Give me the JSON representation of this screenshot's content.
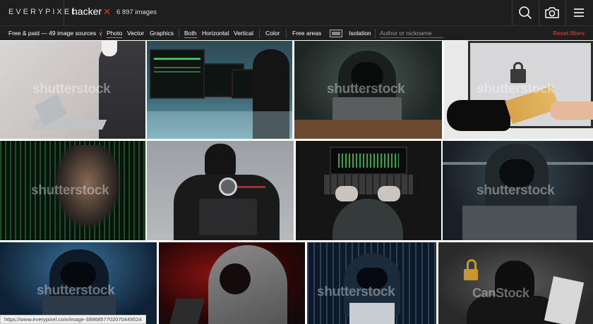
{
  "header": {
    "logo": "EVERYPIXEL",
    "query": "hacker",
    "clear_icon": "close-x",
    "image_count": "6 897 images",
    "icons": [
      "search-icon",
      "camera-icon",
      "menu-icon"
    ]
  },
  "filters": {
    "sources": "Free & paid — 49 image sources",
    "type_photo": "Photo",
    "type_vector": "Vector",
    "type_graphics": "Graphics",
    "orient_both": "Both",
    "orient_horizontal": "Horizontal",
    "orient_vertical": "Vertical",
    "color": "Color",
    "free_areas": "Free areas",
    "isolation": "Isolation",
    "author_placeholder": "Author or nickname",
    "reset": "Reset filters"
  },
  "images": [
    {
      "subject": "man in suit with mask holding laptop",
      "watermark": "shutterstock"
    },
    {
      "subject": "hacker at multiple monitors",
      "watermark": ""
    },
    {
      "subject": "hooded hacker at laptop",
      "watermark": "shutterstock"
    },
    {
      "subject": "gloved hand taking euro banknotes from laptop",
      "watermark": "shutterstock"
    },
    {
      "subject": "hacker behind green code",
      "watermark": "shutterstock"
    },
    {
      "subject": "masked hacker with magnifying glass",
      "watermark": ""
    },
    {
      "subject": "hooded hacker typing on laptop, top view",
      "watermark": ""
    },
    {
      "subject": "hooded hacker in front of screens",
      "watermark": "shutterstock"
    },
    {
      "subject": "hooded hacker with blue light",
      "watermark": "shutterstock"
    },
    {
      "subject": "hooded man on red background",
      "watermark": ""
    },
    {
      "subject": "hooded hacker with binary code",
      "watermark": "shutterstock"
    },
    {
      "subject": "masked burglar with open padlock",
      "watermark": "CanStock"
    }
  ],
  "status_url": "https://www.everypixel.com/image-3896857702070449524",
  "colors": {
    "accent": "#35b18a",
    "reset": "#e0463a",
    "bar": "#1e1e1e"
  }
}
